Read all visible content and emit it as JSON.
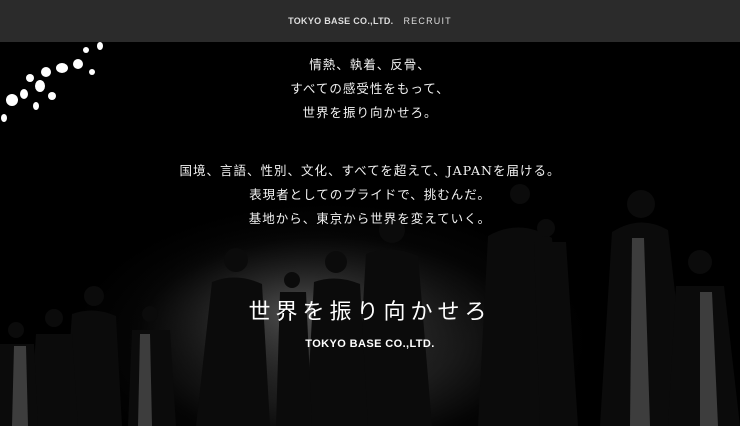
{
  "header": {
    "brand": "TOKYO BASE CO.,LTD.",
    "section": "RECRUIT"
  },
  "hero": {
    "lines_group1": [
      "情熱、執着、反骨、",
      "すべての感受性をもって、",
      "世界を振り向かせろ。"
    ],
    "lines_group2": [
      "国境、言語、性別、文化、すべてを超えて、JAPANを届ける。",
      "表現者としてのプライドで、挑むんだ。",
      "基地から、東京から世界を変えていく。"
    ],
    "headline": "世界を振り向かせろ",
    "logo": "TOKYO BASE CO.,LTD."
  }
}
